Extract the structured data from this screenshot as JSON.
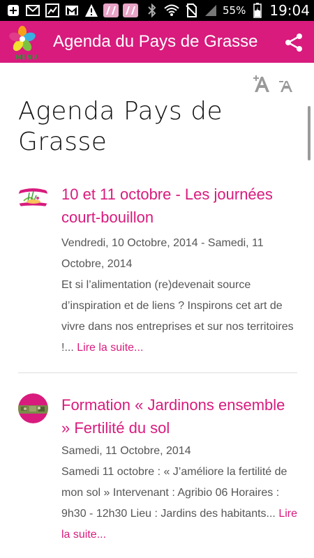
{
  "status_bar": {
    "battery_percent": "55%",
    "time": "19:04",
    "icons": [
      "add-icon",
      "mail-icon",
      "chart-icon",
      "gmail-icon",
      "warning-icon",
      "app-icon",
      "app-icon",
      "bluetooth-icon",
      "wifi-icon",
      "no-sim-icon",
      "signal-icon",
      "battery-icon"
    ]
  },
  "app_bar": {
    "menu_label": "MENU",
    "title": "Agenda du Pays de Grasse",
    "share_icon": "share-icon"
  },
  "colors": {
    "accent": "#d81b7d",
    "text_gray": "#555555"
  },
  "page": {
    "title": "Agenda Pays de Grasse",
    "font_increase_icon": "font-size-increase-icon",
    "font_decrease_icon": "font-size-decrease-icon"
  },
  "articles": [
    {
      "title": "10 et 11 octobre - Les journées court-bouillon",
      "date": "Vendredi, 10 Octobre, 2014 - Samedi, 11 Octobre, 2014",
      "excerpt": "Et si l’alimentation (re)devenait source d’inspiration et de liens ?  Inspirons cet art de vivre dans nos entreprises et sur nos territoires !...",
      "read_more": "Lire la suite..."
    },
    {
      "title": "Formation « Jardinons ensemble » Fertilité du sol",
      "date": "Samedi, 11 Octobre, 2014",
      "excerpt": "Samedi 11 octobre : « J’améliore la fertilité de mon sol » Intervenant : Agribio 06 Horaires : 9h30 - 12h30 Lieu : Jardins des habitants...",
      "read_more": "Lire la suite..."
    }
  ]
}
